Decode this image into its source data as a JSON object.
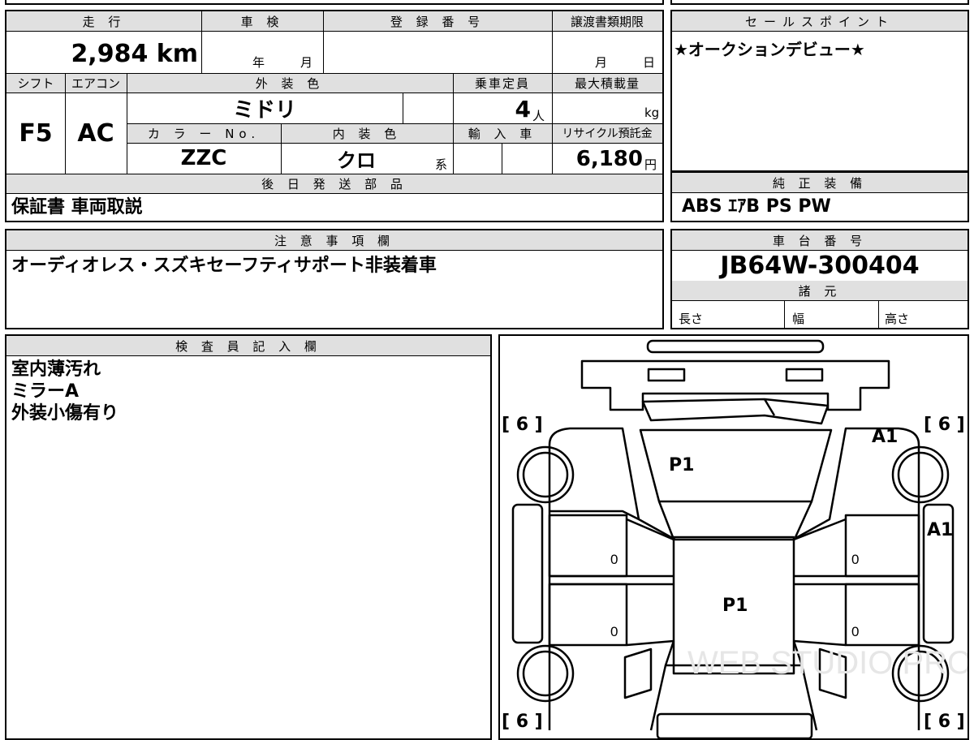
{
  "main_table": {
    "headers": {
      "mileage": "走 行",
      "inspection": "車 検",
      "registration": "登 録 番 号",
      "transfer_deadline": "譲渡書類期限",
      "shift": "シフト",
      "aircon": "エアコン",
      "exterior_color": "外 装 色",
      "capacity": "乗車定員",
      "max_load": "最大積載量",
      "color_no": "カ ラ ー No.",
      "interior_color": "内 装 色",
      "import": "輸 入 車",
      "recycle": "リサイクル預託金",
      "later_parts": "後 日 発 送 部 品"
    },
    "values": {
      "mileage": "2,984 km",
      "insp_year_unit": "年",
      "insp_month_unit": "月",
      "transfer_month_unit": "月",
      "transfer_day_unit": "日",
      "shift": "F5",
      "aircon": "AC",
      "exterior_color": "ミドリ",
      "capacity": "4",
      "capacity_unit": "人",
      "max_load_unit": "kg",
      "color_no": "ZZC",
      "interior_color": "クロ",
      "interior_suffix": "系",
      "recycle": "6,180",
      "recycle_unit": "円",
      "later_parts": "保証書 車両取説"
    }
  },
  "sales_point": {
    "header": "セールスポイント",
    "text": "★オークションデビュー★"
  },
  "standard_equipment": {
    "header": "純 正 装 備",
    "text": "ABS ｴｱB PS PW"
  },
  "notes": {
    "header": "注 意 事 項 欄",
    "text": "オーディオレス・スズキセーフティサポート非装着車"
  },
  "chassis": {
    "header": "車 台 番 号",
    "value": "JB64W-300404",
    "spec_header": "諸 元",
    "length_label": "長さ",
    "width_label": "幅",
    "height_label": "高さ"
  },
  "inspector": {
    "header": "検 査 員 記 入 欄",
    "lines": [
      "室内薄汚れ",
      "ミラーA",
      "外装小傷有り"
    ]
  },
  "diagram": {
    "tire_tl": "[ 6 ]",
    "tire_tr": "[ 6 ]",
    "tire_bl": "[ 6 ]",
    "tire_br": "[ 6 ]",
    "mark_hood": "P1",
    "mark_roof": "P1",
    "mark_front_right": "A1",
    "mark_right_side": "A1",
    "door_fl": "0",
    "door_rl": "0",
    "door_fr": "0",
    "door_rr": "0",
    "watermark": "WEB STUDIO PRO"
  }
}
